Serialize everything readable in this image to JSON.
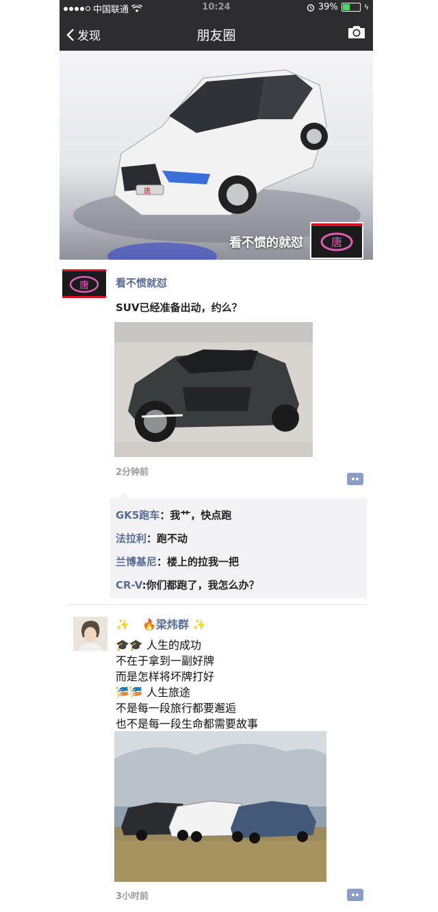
{
  "status_bar": {
    "carrier": "中国联通",
    "time": "10:24",
    "battery": "39%",
    "battery_level": 0.39
  },
  "nav": {
    "back_label": "发现",
    "title": "朋友圈"
  },
  "cover": {
    "user_name": "看不惯的就怼"
  },
  "posts": [
    {
      "user": "看不惯就怼",
      "text": "SUV已经准备出动，约么？",
      "time": "2分钟前",
      "comments": [
        {
          "name": "GK5跑车",
          "sep": "：",
          "text": "我艹，快点跑"
        },
        {
          "name": "法拉利",
          "sep": "：",
          "text": "跑不动"
        },
        {
          "name": "兰博基尼",
          "sep": "：",
          "text": "楼上的拉我一把"
        },
        {
          "name": "CR-V",
          "sep": ":",
          "text": "你们都跑了，我怎么办？"
        }
      ]
    },
    {
      "user": "梁炜群",
      "lines": [
        "人生的成功",
        "不在于拿到一副好牌",
        "而是怎样将坏牌打好",
        "人生旅途",
        "不是每一段旅行都要邂逅",
        "也不是每一段生命都需要故事"
      ],
      "time": "3小时前"
    }
  ]
}
